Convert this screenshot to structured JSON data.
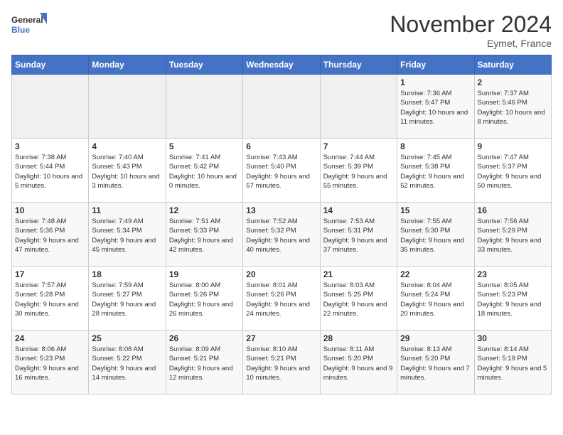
{
  "logo": {
    "line1": "General",
    "line2": "Blue"
  },
  "title": "November 2024",
  "location": "Eymet, France",
  "days_of_week": [
    "Sunday",
    "Monday",
    "Tuesday",
    "Wednesday",
    "Thursday",
    "Friday",
    "Saturday"
  ],
  "weeks": [
    [
      {
        "day": "",
        "content": ""
      },
      {
        "day": "",
        "content": ""
      },
      {
        "day": "",
        "content": ""
      },
      {
        "day": "",
        "content": ""
      },
      {
        "day": "",
        "content": ""
      },
      {
        "day": "1",
        "content": "Sunrise: 7:36 AM\nSunset: 5:47 PM\nDaylight: 10 hours and 11 minutes."
      },
      {
        "day": "2",
        "content": "Sunrise: 7:37 AM\nSunset: 5:46 PM\nDaylight: 10 hours and 8 minutes."
      }
    ],
    [
      {
        "day": "3",
        "content": "Sunrise: 7:38 AM\nSunset: 5:44 PM\nDaylight: 10 hours and 5 minutes."
      },
      {
        "day": "4",
        "content": "Sunrise: 7:40 AM\nSunset: 5:43 PM\nDaylight: 10 hours and 3 minutes."
      },
      {
        "day": "5",
        "content": "Sunrise: 7:41 AM\nSunset: 5:42 PM\nDaylight: 10 hours and 0 minutes."
      },
      {
        "day": "6",
        "content": "Sunrise: 7:43 AM\nSunset: 5:40 PM\nDaylight: 9 hours and 57 minutes."
      },
      {
        "day": "7",
        "content": "Sunrise: 7:44 AM\nSunset: 5:39 PM\nDaylight: 9 hours and 55 minutes."
      },
      {
        "day": "8",
        "content": "Sunrise: 7:45 AM\nSunset: 5:38 PM\nDaylight: 9 hours and 52 minutes."
      },
      {
        "day": "9",
        "content": "Sunrise: 7:47 AM\nSunset: 5:37 PM\nDaylight: 9 hours and 50 minutes."
      }
    ],
    [
      {
        "day": "10",
        "content": "Sunrise: 7:48 AM\nSunset: 5:36 PM\nDaylight: 9 hours and 47 minutes."
      },
      {
        "day": "11",
        "content": "Sunrise: 7:49 AM\nSunset: 5:34 PM\nDaylight: 9 hours and 45 minutes."
      },
      {
        "day": "12",
        "content": "Sunrise: 7:51 AM\nSunset: 5:33 PM\nDaylight: 9 hours and 42 minutes."
      },
      {
        "day": "13",
        "content": "Sunrise: 7:52 AM\nSunset: 5:32 PM\nDaylight: 9 hours and 40 minutes."
      },
      {
        "day": "14",
        "content": "Sunrise: 7:53 AM\nSunset: 5:31 PM\nDaylight: 9 hours and 37 minutes."
      },
      {
        "day": "15",
        "content": "Sunrise: 7:55 AM\nSunset: 5:30 PM\nDaylight: 9 hours and 35 minutes."
      },
      {
        "day": "16",
        "content": "Sunrise: 7:56 AM\nSunset: 5:29 PM\nDaylight: 9 hours and 33 minutes."
      }
    ],
    [
      {
        "day": "17",
        "content": "Sunrise: 7:57 AM\nSunset: 5:28 PM\nDaylight: 9 hours and 30 minutes."
      },
      {
        "day": "18",
        "content": "Sunrise: 7:59 AM\nSunset: 5:27 PM\nDaylight: 9 hours and 28 minutes."
      },
      {
        "day": "19",
        "content": "Sunrise: 8:00 AM\nSunset: 5:26 PM\nDaylight: 9 hours and 26 minutes."
      },
      {
        "day": "20",
        "content": "Sunrise: 8:01 AM\nSunset: 5:26 PM\nDaylight: 9 hours and 24 minutes."
      },
      {
        "day": "21",
        "content": "Sunrise: 8:03 AM\nSunset: 5:25 PM\nDaylight: 9 hours and 22 minutes."
      },
      {
        "day": "22",
        "content": "Sunrise: 8:04 AM\nSunset: 5:24 PM\nDaylight: 9 hours and 20 minutes."
      },
      {
        "day": "23",
        "content": "Sunrise: 8:05 AM\nSunset: 5:23 PM\nDaylight: 9 hours and 18 minutes."
      }
    ],
    [
      {
        "day": "24",
        "content": "Sunrise: 8:06 AM\nSunset: 5:23 PM\nDaylight: 9 hours and 16 minutes."
      },
      {
        "day": "25",
        "content": "Sunrise: 8:08 AM\nSunset: 5:22 PM\nDaylight: 9 hours and 14 minutes."
      },
      {
        "day": "26",
        "content": "Sunrise: 8:09 AM\nSunset: 5:21 PM\nDaylight: 9 hours and 12 minutes."
      },
      {
        "day": "27",
        "content": "Sunrise: 8:10 AM\nSunset: 5:21 PM\nDaylight: 9 hours and 10 minutes."
      },
      {
        "day": "28",
        "content": "Sunrise: 8:11 AM\nSunset: 5:20 PM\nDaylight: 9 hours and 9 minutes."
      },
      {
        "day": "29",
        "content": "Sunrise: 8:13 AM\nSunset: 5:20 PM\nDaylight: 9 hours and 7 minutes."
      },
      {
        "day": "30",
        "content": "Sunrise: 8:14 AM\nSunset: 5:19 PM\nDaylight: 9 hours and 5 minutes."
      }
    ]
  ]
}
